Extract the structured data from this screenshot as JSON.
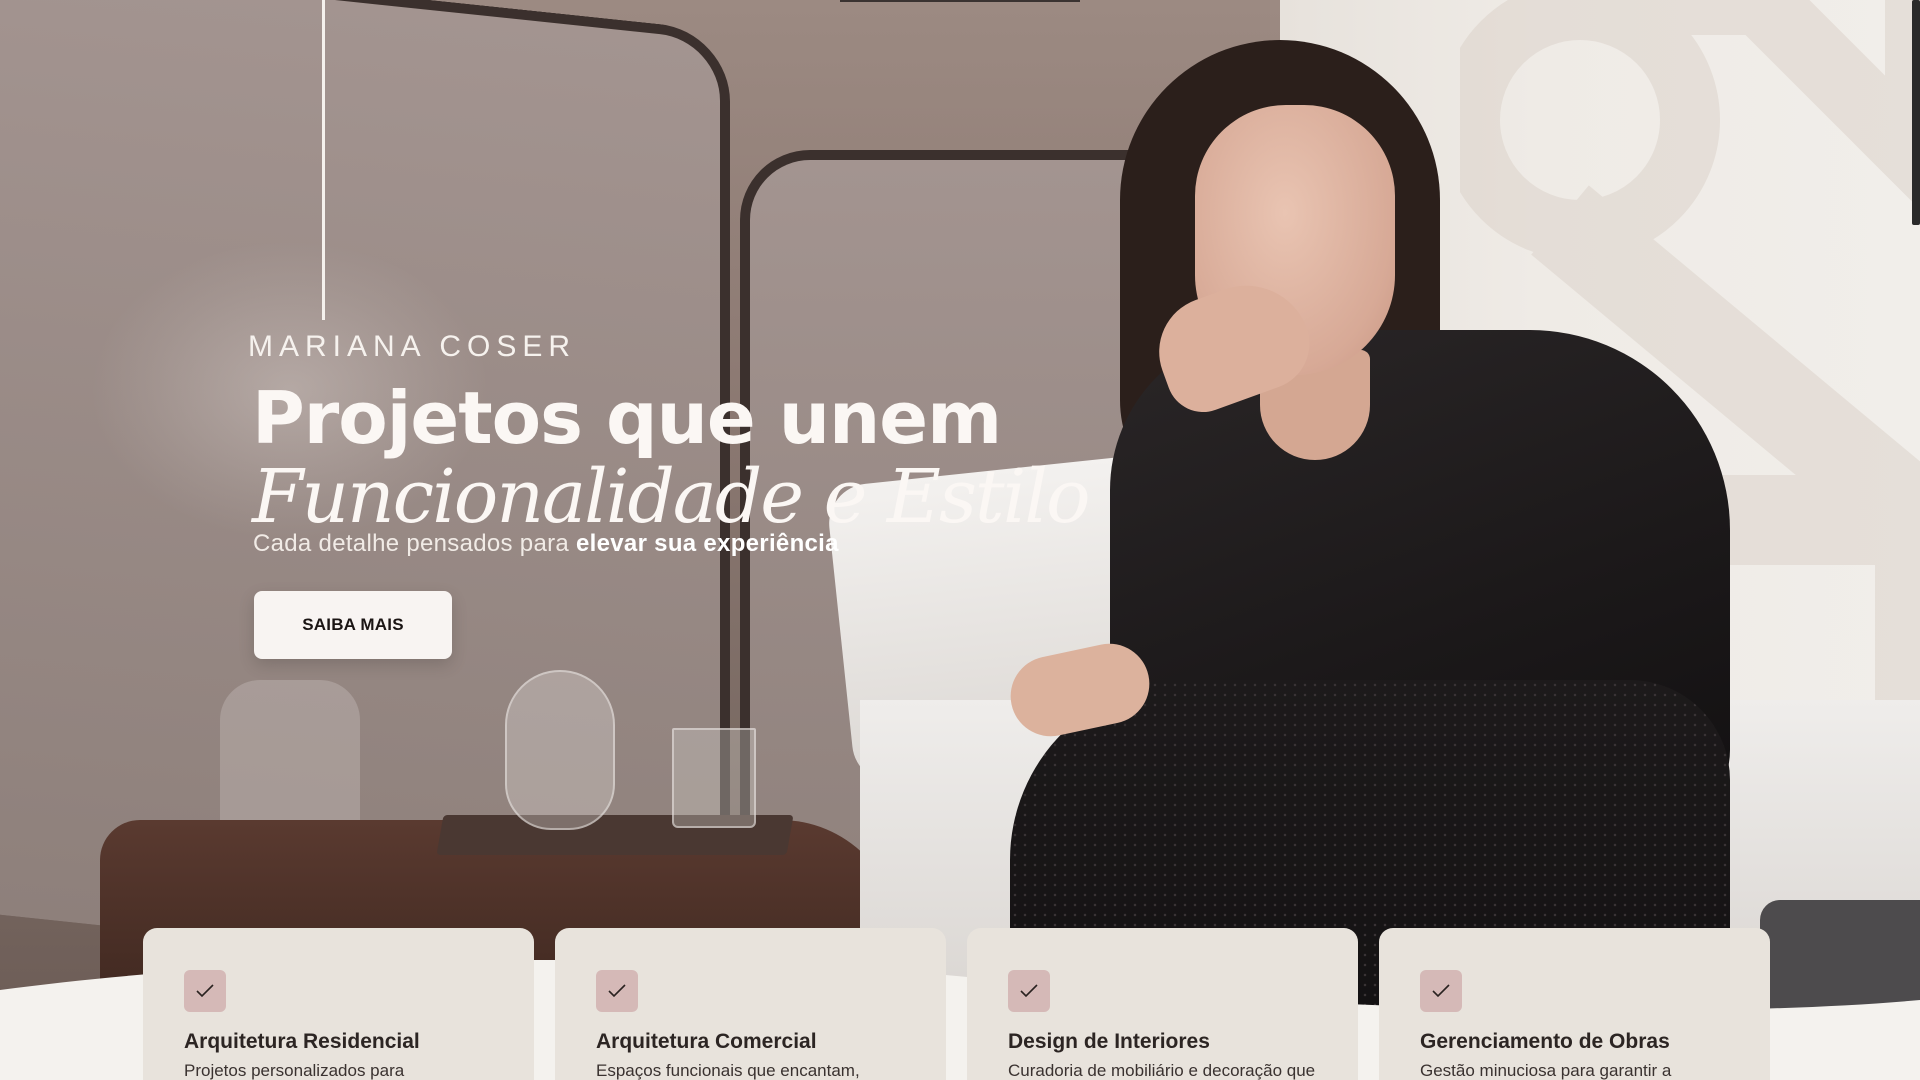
{
  "brand": {
    "name": "MARIANA COSER"
  },
  "hero": {
    "headline_line1": "Projetos que unem",
    "headline_line2": "Funcionalidade e Estilo",
    "subtitle_regular": "Cada detalhe pensados para",
    "subtitle_bold": "elevar sua experiência",
    "cta_label": "SAIBA MAIS"
  },
  "services": [
    {
      "icon": "check-icon",
      "title": "Arquitetura Residencial",
      "description": "Projetos personalizados para residências de alto padrão, valorizando"
    },
    {
      "icon": "check-icon",
      "title": "Arquitetura Comercial",
      "description": "Espaços funcionais que encantam, refletindo a identidade de marcas"
    },
    {
      "icon": "check-icon",
      "title": "Design de Interiores",
      "description": "Curadoria de mobiliário e decoração que traduzem personalidade com"
    },
    {
      "icon": "check-icon",
      "title": "Gerenciamento de Obras",
      "description": "Gestão minuciosa para garantir a excelência em cada etapa do projeto"
    }
  ],
  "colors": {
    "accent": "#d5b9b7",
    "card_bg": "#e8e3dc",
    "page_bg": "#f4f2ee",
    "cta_bg": "#f8f4f2"
  }
}
